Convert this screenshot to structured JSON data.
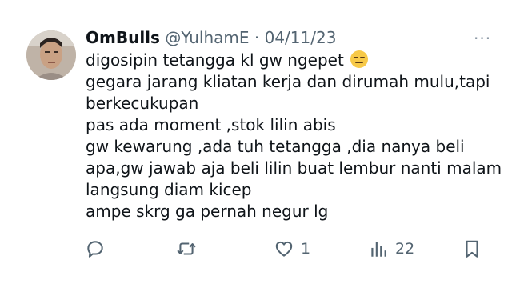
{
  "tweet": {
    "display_name": "OmBulls",
    "handle": "@YulhamE",
    "separator": "·",
    "date": "04/11/23",
    "more_label": "···",
    "lines": [
      "digosipin tetangga kl gw ngepet",
      "gegara jarang kliatan kerja dan dirumah mulu,tapi",
      "berkecukupan",
      "pas ada moment ,stok lilin abis",
      "gw kewarung ,ada tuh tetangga ,dia nanya beli",
      "apa,gw jawab aja beli lilin buat lembur nanti malam",
      "langsung diam kicep",
      "ampe skrg ga pernah negur lg"
    ],
    "emoji": "expressionless-face-emoji"
  },
  "actions": {
    "reply_icon": "reply-icon",
    "retweet_icon": "retweet-icon",
    "like_icon": "heart-icon",
    "like_count": "1",
    "views_icon": "views-icon",
    "views_count": "22",
    "bookmark_icon": "bookmark-icon"
  },
  "colors": {
    "text": "#0f1419",
    "secondary": "#536471",
    "background": "#ffffff"
  }
}
